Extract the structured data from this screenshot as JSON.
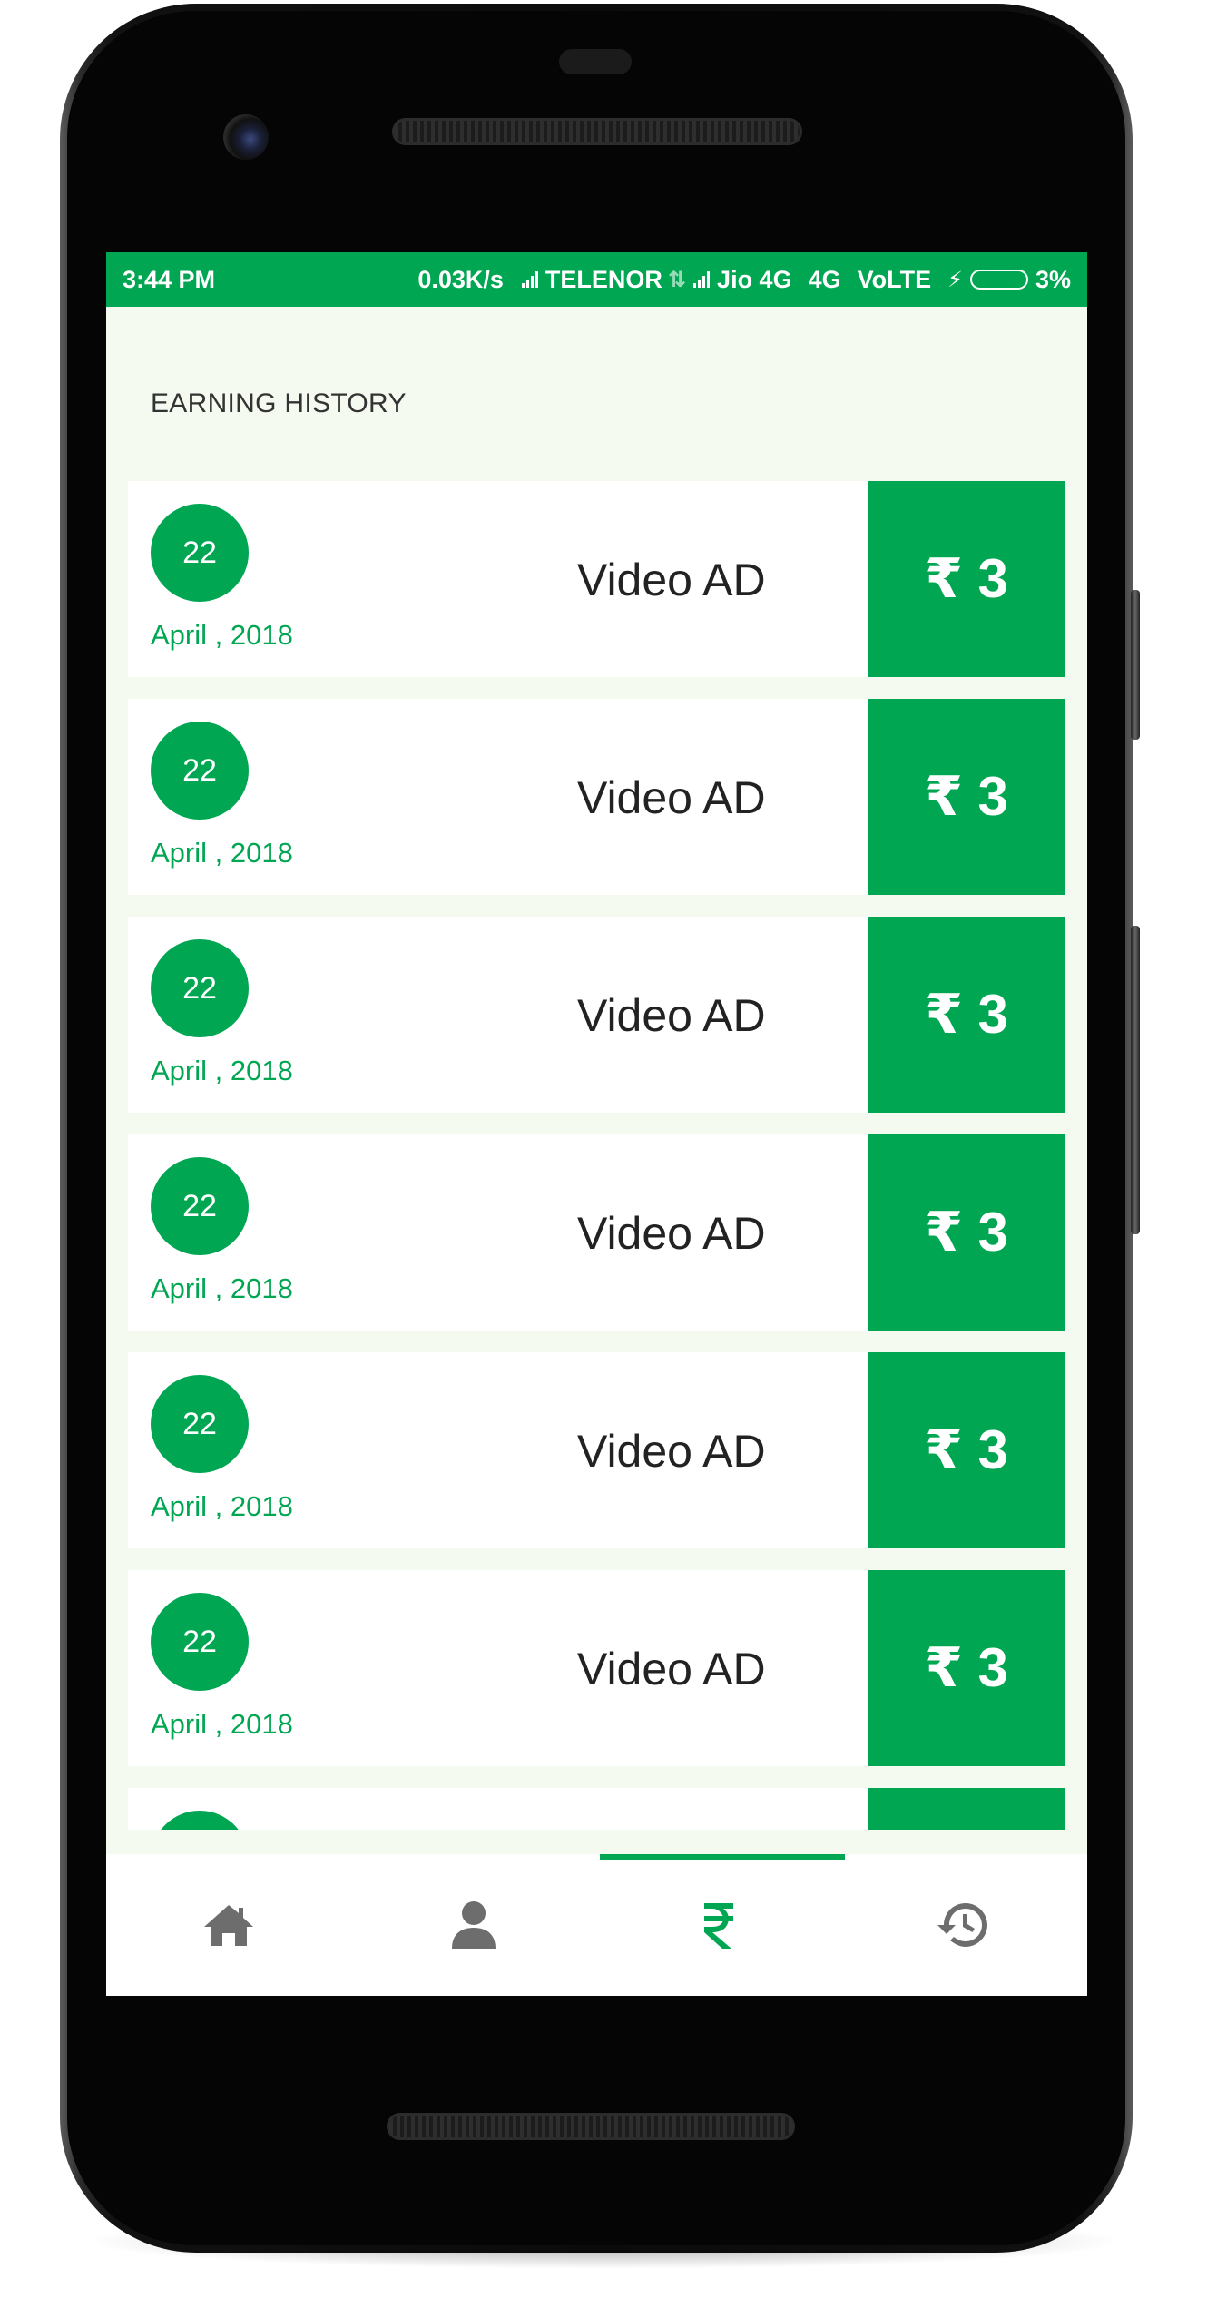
{
  "status_bar": {
    "time": "3:44 PM",
    "speed": "0.03K/s",
    "carrier1": "TELENOR",
    "carrier2": "Jio 4G",
    "network": "4G",
    "volte": "VoLTE",
    "battery": "3%"
  },
  "page": {
    "title": "EARNING HISTORY"
  },
  "colors": {
    "accent": "#00a651",
    "background": "#f5faf0"
  },
  "earnings": [
    {
      "day": "22",
      "date": "April , 2018",
      "title": "Video AD",
      "amount": "₹ 3"
    },
    {
      "day": "22",
      "date": "April , 2018",
      "title": "Video AD",
      "amount": "₹ 3"
    },
    {
      "day": "22",
      "date": "April , 2018",
      "title": "Video AD",
      "amount": "₹ 3"
    },
    {
      "day": "22",
      "date": "April , 2018",
      "title": "Video AD",
      "amount": "₹ 3"
    },
    {
      "day": "22",
      "date": "April , 2018",
      "title": "Video AD",
      "amount": "₹ 3"
    },
    {
      "day": "22",
      "date": "April , 2018",
      "title": "Video AD",
      "amount": "₹ 3"
    },
    {
      "day": "",
      "date": "",
      "title": "",
      "amount": ""
    }
  ],
  "nav": {
    "items": [
      {
        "icon": "home-icon",
        "active": false
      },
      {
        "icon": "user-icon",
        "active": false
      },
      {
        "icon": "rupee-icon",
        "active": true
      },
      {
        "icon": "history-icon",
        "active": false
      }
    ]
  }
}
